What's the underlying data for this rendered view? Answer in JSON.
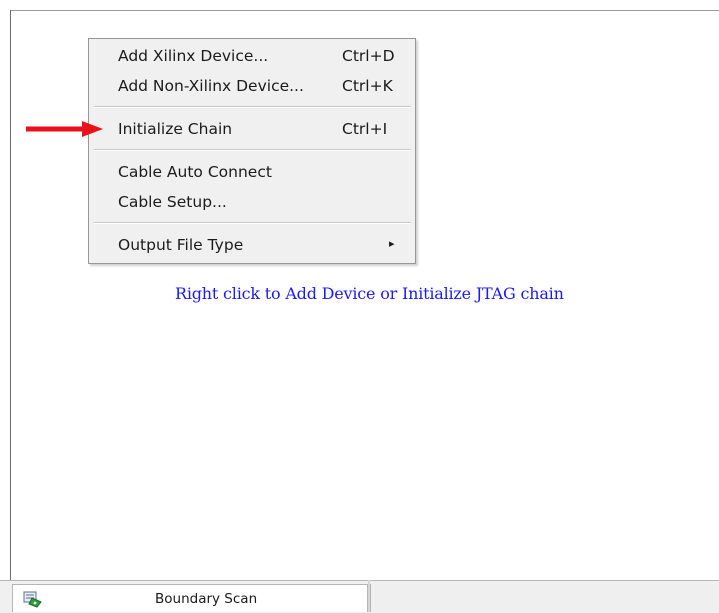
{
  "context_menu": {
    "items": [
      {
        "label": "Add Xilinx Device...",
        "shortcut": "Ctrl+D"
      },
      {
        "label": "Add Non-Xilinx Device...",
        "shortcut": "Ctrl+K"
      },
      {
        "label": "Initialize Chain",
        "shortcut": "Ctrl+I"
      },
      {
        "label": "Cable Auto Connect",
        "shortcut": ""
      },
      {
        "label": "Cable Setup...",
        "shortcut": ""
      },
      {
        "label": "Output File Type",
        "shortcut": ""
      }
    ],
    "submenu_glyph": "▸"
  },
  "canvas": {
    "hint_text": "Right click to Add Device or Initialize JTAG chain"
  },
  "annotation": {
    "arrow_color": "#e8131a",
    "points_to": "Initialize Chain"
  },
  "tabs": {
    "boundary_scan_label": "Boundary Scan",
    "boundary_scan_icon": "boundary-scan-icon"
  },
  "colors": {
    "hint_text": "#1a1aff",
    "menu_background": "#f0f0f0"
  }
}
